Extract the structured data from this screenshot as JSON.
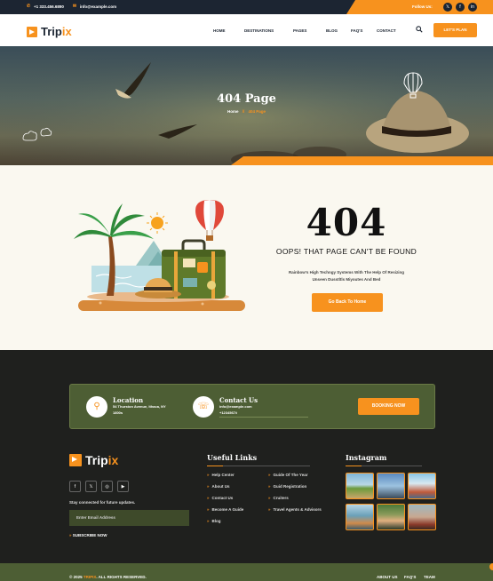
{
  "topbar": {
    "phone": "+1 333.456.6890",
    "email": "info@example.com",
    "follow_label": "Follow Us:",
    "social": [
      {
        "icon": "x-icon",
        "glyph": "𝕏"
      },
      {
        "icon": "facebook-icon",
        "glyph": "f"
      },
      {
        "icon": "linkedin-icon",
        "glyph": "in"
      }
    ]
  },
  "header": {
    "logo_a": "Trip",
    "logo_b": "ix",
    "nav": [
      "HOME",
      "DESTINATIONS",
      "PAGES",
      "BLOG",
      "FAQ'S",
      "CONTACT"
    ],
    "cta": "LET'S PLAN"
  },
  "hero": {
    "title": "404 Page",
    "breadcrumb_home": "Home",
    "breadcrumb_sep": "//",
    "breadcrumb_current": "404 Page"
  },
  "error": {
    "code": "404",
    "heading": "OOPS! THAT PAGE CAN'T BE FOUND",
    "desc_line1": "Rainbow's High Techngy Systems With The Help Of Resizing",
    "desc_line2": "Unseen Dusstltls Miyoutes And Bed",
    "button": "Go Back To Home"
  },
  "footer": {
    "location_title": "Location",
    "location_line1": "54 Thurston Avenue, Ithaca, NY",
    "location_line2": "1800s",
    "contact_title": "Contact Us",
    "contact_line1": "info@example.com",
    "contact_line2": "+1234567#",
    "booking": "BOOKING NOW",
    "logo_a": "Trip",
    "logo_b": "ix",
    "social": [
      {
        "icon": "facebook-icon",
        "glyph": "f"
      },
      {
        "icon": "x-icon",
        "glyph": "𝕏"
      },
      {
        "icon": "instagram-icon",
        "glyph": "◎"
      },
      {
        "icon": "youtube-icon",
        "glyph": "▶"
      }
    ],
    "stay": "Stay connected for future updates.",
    "email_placeholder": "Enter Email Address",
    "subscribe": "SUBSCRIBE NOW",
    "useful_title": "Useful Links",
    "links_col1": [
      "Help Center",
      "About Us",
      "Contact Us",
      "Become A Guide",
      "Blog"
    ],
    "links_col2": [
      "Guide Of The Year",
      "Guid Registration",
      "Cruiters",
      "Travel Agents & Advisors"
    ],
    "instagram_title": "Instagram",
    "copyright_a": "© 2025 ",
    "copyright_b": "TRIPIX",
    "copyright_c": ". ALL RIGHTS RESERVED.",
    "bottom_links": [
      "ABOUT US",
      "FAQ'S",
      "TEAM"
    ]
  },
  "colors": {
    "accent": "#f7921e",
    "dark": "#1c2532",
    "olive": "#4d5e34",
    "footer_bg": "#1f201e"
  }
}
